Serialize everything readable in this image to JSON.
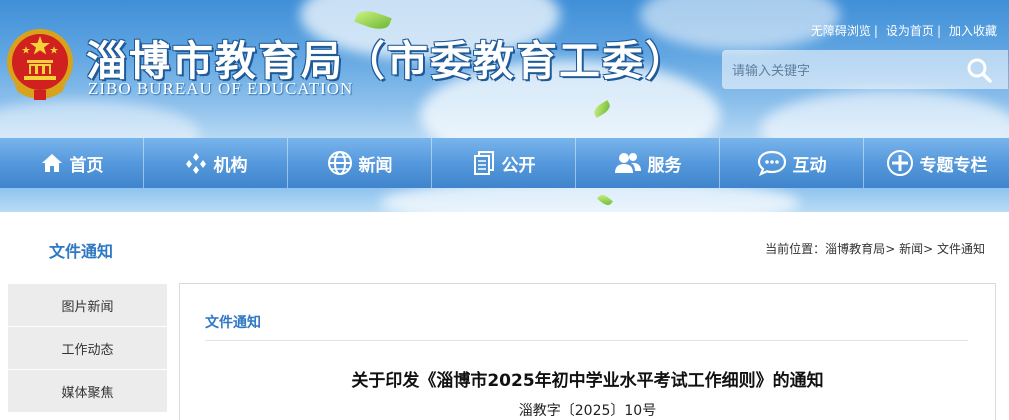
{
  "header": {
    "title": "淄博市教育局（市委教育工委）",
    "subtitle": "ZIBO BUREAU OF EDUCATION",
    "emblem_icon": "national-emblem-icon"
  },
  "top_links": {
    "accessibility": "无障碍浏览",
    "set_home": "设为首页",
    "add_favorite": "加入收藏",
    "separator": "|"
  },
  "search": {
    "placeholder": "请输入关键字",
    "icon": "search-icon"
  },
  "nav": {
    "items": [
      {
        "label": "首页",
        "icon": "home-icon"
      },
      {
        "label": "机构",
        "icon": "organization-icon"
      },
      {
        "label": "新闻",
        "icon": "globe-icon"
      },
      {
        "label": "公开",
        "icon": "documents-icon"
      },
      {
        "label": "服务",
        "icon": "users-icon"
      },
      {
        "label": "互动",
        "icon": "chat-icon"
      },
      {
        "label": "专题专栏",
        "icon": "topics-icon"
      }
    ]
  },
  "sidebar": {
    "title": "文件通知",
    "items": [
      {
        "label": "图片新闻"
      },
      {
        "label": "工作动态"
      },
      {
        "label": "媒体聚焦"
      }
    ]
  },
  "breadcrumb": {
    "prefix": "当前位置：",
    "items": [
      "淄博教育局",
      "新闻",
      "文件通知"
    ],
    "separator": ">"
  },
  "article": {
    "section": "文件通知",
    "title": "关于印发《淄博市2025年初中学业水平考试工作细则》的通知",
    "doc_number": "淄教字〔2025〕10号"
  },
  "colors": {
    "nav_blue": "#5598dc",
    "accent_blue": "#2f78c4",
    "banner_sky": "#62a6e2",
    "menu_bg": "#ececec"
  }
}
